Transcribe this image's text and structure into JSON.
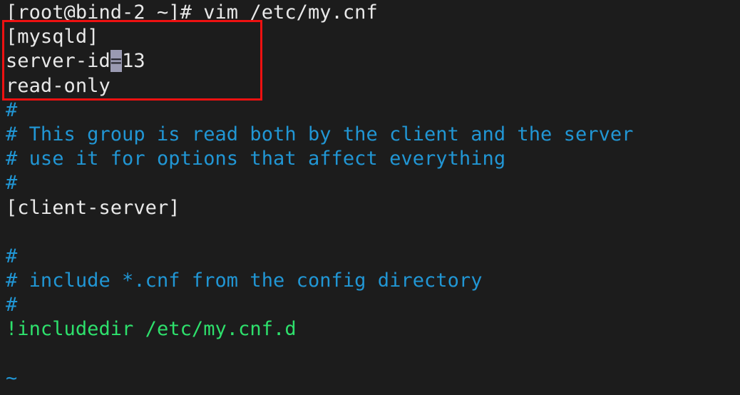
{
  "terminal": {
    "background_color": "#1c1c1c",
    "default_text_color": "#e8e8e8",
    "comment_color": "#2196d4",
    "green_color": "#2ee06c",
    "cursor_color": "#9a9ab2",
    "prompt_line": "[root@bind-2 ~]# vim /etc/my.cnf"
  },
  "editor": {
    "file_path": "/etc/my.cnf",
    "command": "vim /etc/my.cnf",
    "mode": "normal",
    "cursor": {
      "line": 2,
      "column": 10,
      "char": "="
    },
    "lines": [
      {
        "text": "[mysqld]",
        "color": "white"
      },
      {
        "text": "server-id=13",
        "color": "white"
      },
      {
        "text": "read-only",
        "color": "white"
      },
      {
        "text": "#",
        "color": "comment"
      },
      {
        "text": "# This group is read both by the client and the server",
        "color": "comment"
      },
      {
        "text": "# use it for options that affect everything",
        "color": "comment"
      },
      {
        "text": "#",
        "color": "comment"
      },
      {
        "text": "[client-server]",
        "color": "white"
      },
      {
        "text": "",
        "color": "white"
      },
      {
        "text": "#",
        "color": "comment"
      },
      {
        "text": "# include *.cnf from the config directory",
        "color": "comment"
      },
      {
        "text": "#",
        "color": "comment"
      },
      {
        "text": "!includedir /etc/my.cnf.d",
        "color": "green"
      },
      {
        "text": "",
        "color": "white"
      },
      {
        "text": "~",
        "color": "blue"
      }
    ],
    "cursor_segments": {
      "before": "server-id",
      "at": "=",
      "after": "13"
    }
  },
  "annotation": {
    "shape": "rectangle",
    "color": "#ee1111",
    "border_width_px": 3,
    "covers_lines": [
      "[mysqld]",
      "server-id=13",
      "read-only"
    ]
  }
}
